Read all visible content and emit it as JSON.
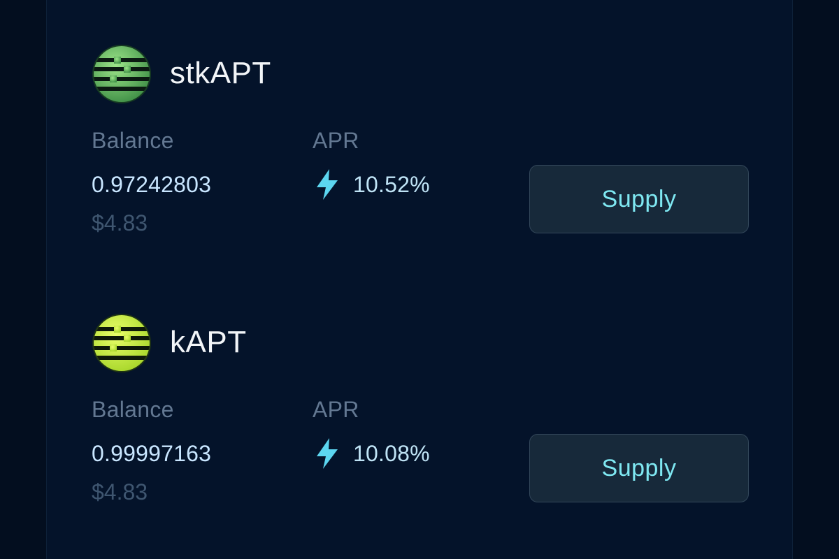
{
  "assets": [
    {
      "name": "stkAPT",
      "icon": "stkapt-token-icon",
      "icon_colors": [
        "#7ed56f",
        "#2f7a3a"
      ],
      "balance_label": "Balance",
      "balance": "0.97242803",
      "usd_value": "$4.83",
      "apr_label": "APR",
      "apr_icon": "lightning-bolt-icon",
      "apr": "10.52%",
      "action_label": "Supply"
    },
    {
      "name": "kAPT",
      "icon": "kapt-token-icon",
      "icon_colors": [
        "#dfff4a",
        "#9ccc25"
      ],
      "balance_label": "Balance",
      "balance": "0.99997163",
      "usd_value": "$4.83",
      "apr_label": "APR",
      "apr_icon": "lightning-bolt-icon",
      "apr": "10.08%",
      "action_label": "Supply"
    }
  ],
  "colors": {
    "background": "#04132a",
    "accent": "#7fe8f2",
    "bolt": "#5cd6f0"
  }
}
